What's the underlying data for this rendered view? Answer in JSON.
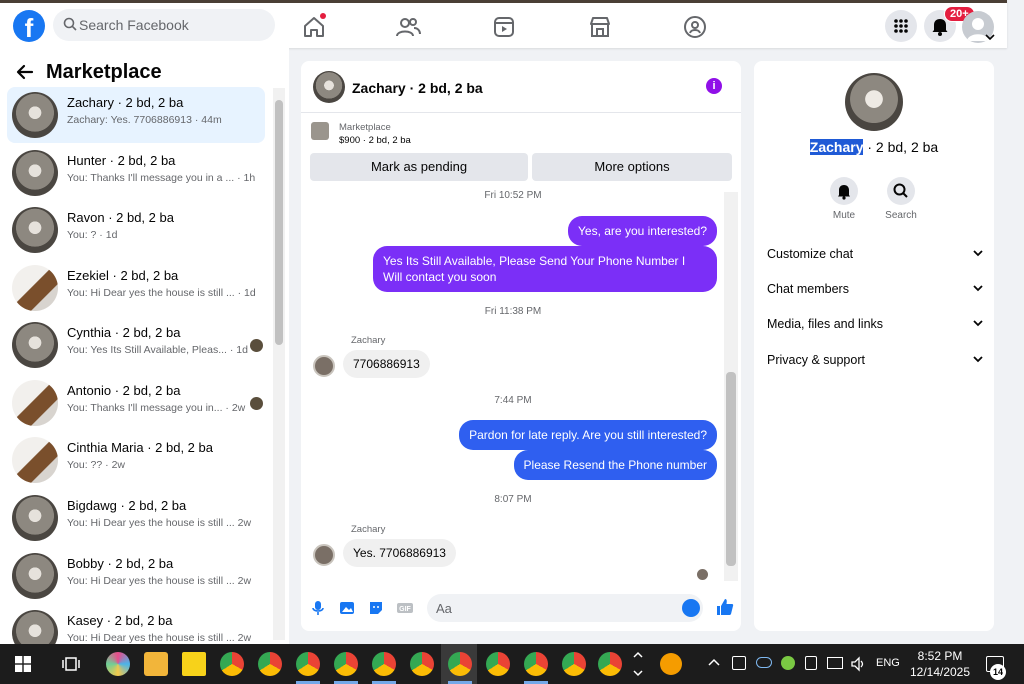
{
  "topbar": {
    "logo_letter": "f",
    "search_placeholder": "Search Facebook",
    "notification_count": "20+"
  },
  "sidebar": {
    "title": "Marketplace",
    "conversations": [
      {
        "name": "Zachary · 2 bd, 2 ba",
        "preview": "Zachary: Yes. 7706886913 · 44m",
        "active": true
      },
      {
        "name": "Hunter · 2 bd, 2 ba",
        "preview": "You: Thanks I'll message you in a ...  · 1h"
      },
      {
        "name": "Ravon · 2 bd, 2 ba",
        "preview": "You: ? · 1d"
      },
      {
        "name": "Ezekiel · 2 bd, 2 ba",
        "preview": "You: Hi Dear yes the house is still ...  · 1d"
      },
      {
        "name": "Cynthia · 2 bd, 2 ba",
        "preview": "You: Yes Its Still Available, Pleas...  · 1d"
      },
      {
        "name": "Antonio · 2 bd, 2 ba",
        "preview": "You: Thanks I'll message you in...  · 2w"
      },
      {
        "name": "Cinthia Maria · 2 bd, 2 ba",
        "preview": "You: ?? · 2w"
      },
      {
        "name": "Bigdawg · 2 bd, 2 ba",
        "preview": "You: Hi Dear yes the house is still ...  2w"
      },
      {
        "name": "Bobby · 2 bd, 2 ba",
        "preview": "You: Hi Dear yes the house is still ...  2w"
      },
      {
        "name": "Kasey · 2 bd, 2 ba",
        "preview": "You: Hi Dear yes the house is still ...  2w"
      }
    ]
  },
  "chat": {
    "title": "Zachary · 2 bd, 2 ba",
    "marketplace_label": "Marketplace",
    "listing": "$900 · 2 bd, 2 ba",
    "mark_pending": "Mark as pending",
    "more_options": "More options",
    "times": [
      "Fri 10:52 PM",
      "Fri 11:38 PM",
      "7:44 PM",
      "8:07 PM"
    ],
    "msg_out_1": "Yes, are you interested?",
    "msg_out_2": "Yes Its Still Available, Please Send Your Phone Number I Will contact you soon",
    "sender": "Zachary",
    "msg_in_1": "7706886913",
    "msg_out_3": "Pardon for late reply. Are you still interested?",
    "msg_out_4": "Please Resend the Phone number",
    "msg_in_2": "Yes. 7706886913",
    "composer_placeholder": "Aa"
  },
  "right": {
    "name_highlight": "Zachary",
    "name_rest": " · 2 bd, 2 ba",
    "mute_label": "Mute",
    "search_label": "Search",
    "items": [
      "Customize chat",
      "Chat members",
      "Media, files and links",
      "Privacy & support"
    ]
  },
  "taskbar": {
    "language": "ENG",
    "time": "8:52 PM",
    "date": "12/14/2025",
    "notification_count": "14"
  }
}
